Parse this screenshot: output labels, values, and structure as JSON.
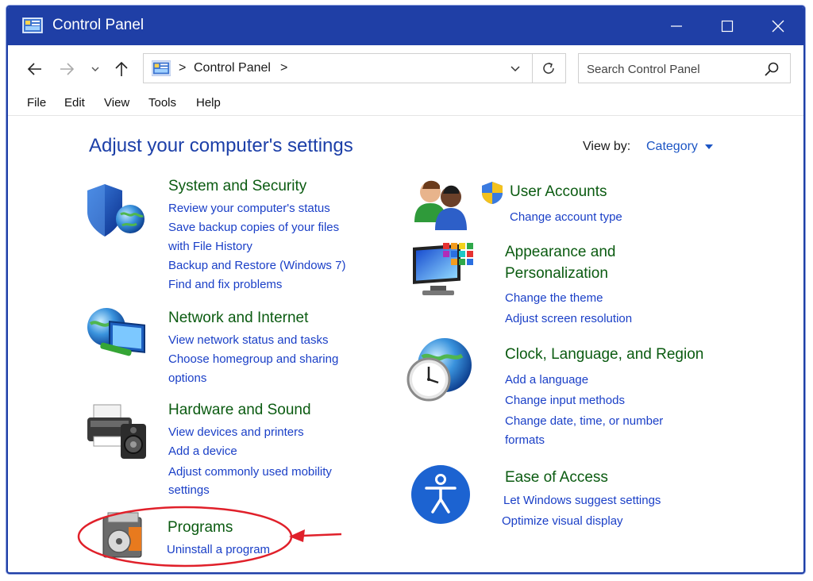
{
  "window": {
    "title": "Control Panel"
  },
  "address": {
    "location": "Control Panel",
    "separator": ">"
  },
  "search": {
    "placeholder": "Search Control Panel"
  },
  "menu": [
    "File",
    "Edit",
    "View",
    "Tools",
    "Help"
  ],
  "heading": "Adjust your computer's settings",
  "view_by": {
    "label": "View by:",
    "value": "Category"
  },
  "categories": [
    {
      "title": "System and Security",
      "icon": "shield-globe-icon",
      "links": [
        "Review your computer's status",
        "Save backup copies of your files",
        "with File History",
        "Backup and Restore (Windows 7)",
        "Find and fix problems"
      ]
    },
    {
      "title": "Network and Internet",
      "icon": "network-globe-icon",
      "links": [
        "View network status and tasks",
        "Choose homegroup and sharing",
        "options"
      ]
    },
    {
      "title": "Hardware and Sound",
      "icon": "printer-speaker-icon",
      "links": [
        "View devices and printers",
        "Add a device",
        "Adjust commonly used mobility",
        "settings"
      ]
    },
    {
      "title": "Programs",
      "icon": "programs-icon",
      "links": [
        "Uninstall a program"
      ]
    },
    {
      "title": "User Accounts",
      "icon": "users-icon",
      "links": [
        "Change account type"
      ]
    },
    {
      "title_lines": [
        "Appearance and",
        "Personalization"
      ],
      "icon": "monitor-palette-icon",
      "links": [
        "Change the theme",
        "Adjust screen resolution"
      ]
    },
    {
      "title": "Clock, Language, and Region",
      "icon": "clock-globe-icon",
      "links": [
        "Add a language",
        "Change input methods",
        "Change date, time, or number",
        "formats"
      ]
    },
    {
      "title": "Ease of Access",
      "icon": "accessibility-icon",
      "links": [
        "Let Windows suggest settings",
        "Optimize visual display"
      ]
    }
  ],
  "colors": {
    "titlebar": "#1f3fa6",
    "heading": "#1c3fa8",
    "category_title": "#0b5b11",
    "link": "#1a3fc7",
    "annotation": "#e0202a"
  }
}
